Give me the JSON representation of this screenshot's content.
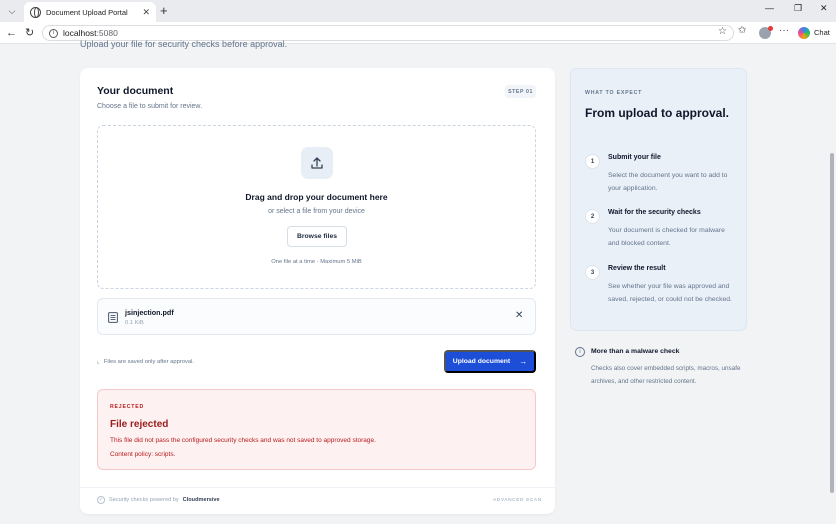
{
  "browser": {
    "tab_title": "Document Upload Portal",
    "tab_close": "✕",
    "new_tab": "+",
    "url_host": "localhost",
    "url_port": ":5080",
    "chat_label": "Chat"
  },
  "page": {
    "subtitle": "Upload your file for security checks before approval."
  },
  "upload_card": {
    "title": "Your document",
    "subtitle": "Choose a file to submit for review.",
    "step_badge": "STEP 01",
    "dropzone": {
      "title": "Drag and drop your document here",
      "subtitle": "or select a file from your device",
      "browse_label": "Browse files",
      "hint": "One file at a time · Maximum 5 MiB"
    },
    "file": {
      "name": "jsinjection.pdf",
      "size": "0.1 KiB",
      "remove_label": "✕"
    },
    "saved_note": "Files are saved only after approval.",
    "upload_label": "Upload document",
    "upload_arrow": "→",
    "result": {
      "label": "REJECTED",
      "title": "File rejected",
      "description": "This file did not pass the configured security checks and was not saved to approved storage.",
      "policy": "Content policy: scripts."
    },
    "footer": {
      "powered_prefix": "Security checks powered by",
      "powered_brand": "Cloudmersive",
      "mode": "ADVANCED SCAN"
    }
  },
  "side_panel": {
    "label": "WHAT TO EXPECT",
    "title": "From upload to approval.",
    "steps": [
      {
        "num": "1",
        "title": "Submit your file",
        "desc": "Select the document you want to add to your application."
      },
      {
        "num": "2",
        "title": "Wait for the security checks",
        "desc": "Your document is checked for malware and blocked content."
      },
      {
        "num": "3",
        "title": "Review the result",
        "desc": "See whether your file was approved and saved, rejected, or could not be checked."
      }
    ]
  },
  "info_card": {
    "title": "More than a malware check",
    "desc": "Checks also cover embedded scripts, macros, unsafe archives, and other restricted content."
  },
  "colors": {
    "primary": "#1d4ed8",
    "rejected_bg": "#fdf1f1",
    "rejected_text": "#991b1b"
  }
}
